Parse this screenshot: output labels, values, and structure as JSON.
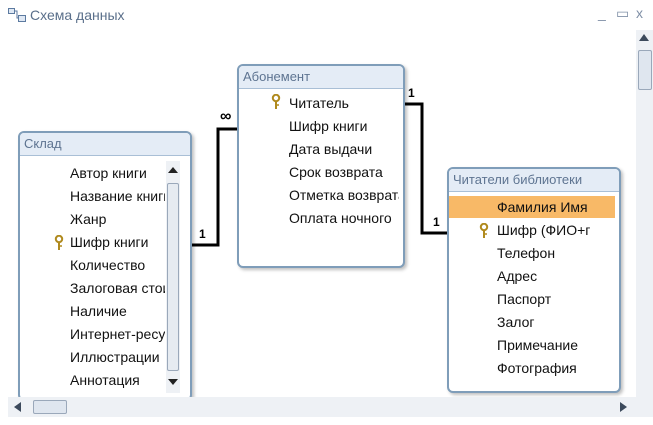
{
  "window": {
    "title": "Схема данных",
    "minimize_glyph": "_",
    "maximize_glyph": "▭",
    "close_glyph": "x"
  },
  "tables": {
    "sklad": {
      "title": "Склад",
      "fields": [
        "Автор книги",
        "Название книги",
        "Жанр",
        "Шифр книги",
        "Количество",
        "Залоговая стоимость",
        "Наличие",
        "Интернет-ресурс",
        "Иллюстрации",
        "Аннотация"
      ]
    },
    "abonement": {
      "title": "Абонемент",
      "fields": [
        "Читатель",
        "Шифр книги",
        "Дата выдачи",
        "Срок возврата",
        "Отметка возврата",
        "Оплата ночного"
      ]
    },
    "chitateli": {
      "title": "Читатели библиотеки",
      "fields": [
        "Фамилия Имя",
        "Шифр (ФИО+г",
        "Телефон",
        "Адрес",
        "Паспорт",
        "Залог",
        "Примечание",
        "Фотография"
      ]
    }
  },
  "relationships": {
    "r1": {
      "one": "1",
      "many": "∞"
    },
    "r2": {
      "one_left": "1",
      "one_right": "1"
    }
  },
  "icons": {
    "window": "relationships-window-icon",
    "key": "primary-key-icon"
  },
  "colors": {
    "table_border": "#7f9db9",
    "table_header_bg": "#e4ecf6",
    "selected_field": "#f8b967",
    "relationship_line": "#000000"
  }
}
